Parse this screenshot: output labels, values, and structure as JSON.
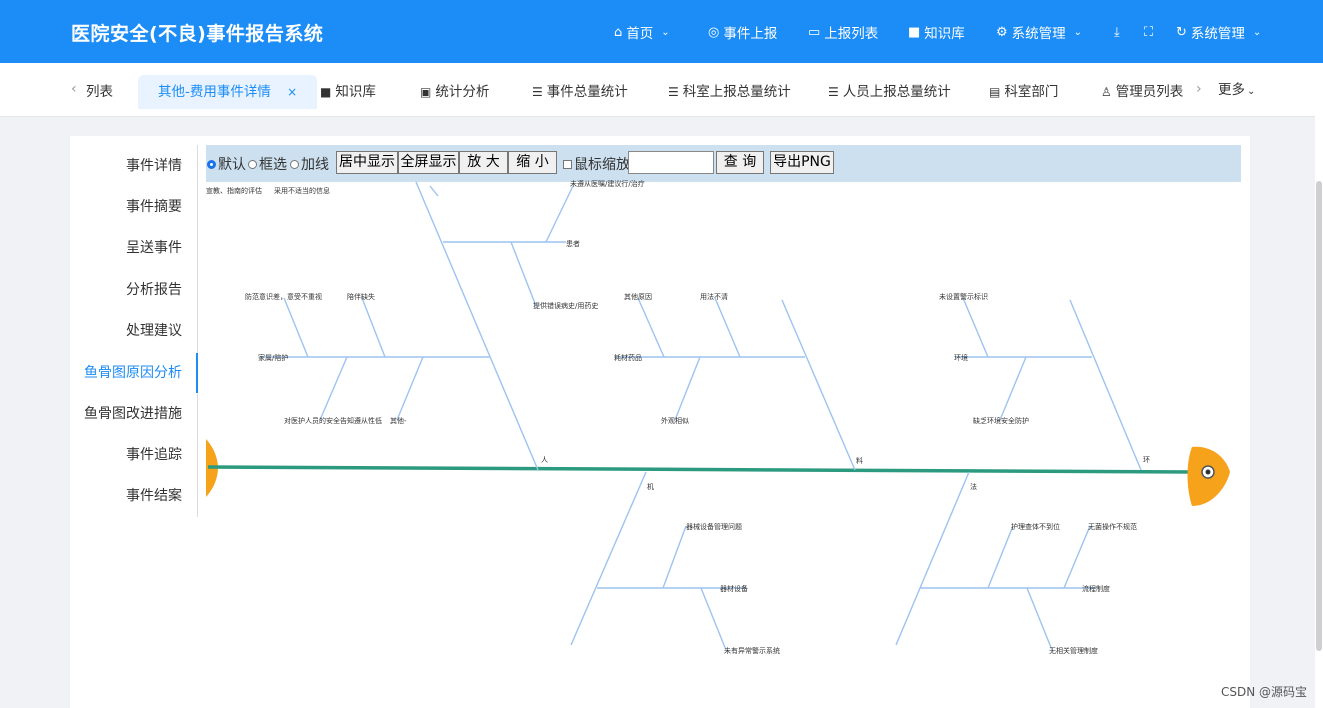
{
  "header": {
    "title": "医院安全(不良)事件报告系统",
    "nav": [
      {
        "label": "首页",
        "icon": "home-icon"
      },
      {
        "label": "事件上报",
        "icon": "report-icon"
      },
      {
        "label": "上报列表",
        "icon": "list-icon"
      },
      {
        "label": "知识库",
        "icon": "book-icon"
      },
      {
        "label": "系统管理",
        "icon": "gear-icon"
      },
      {
        "label": "系统管理",
        "icon": "refresh-icon"
      }
    ]
  },
  "tabs": {
    "back": "列表",
    "active": "其他-费用事件详情",
    "close": "×",
    "items": [
      "知识库",
      "统计分析",
      "事件总量统计",
      "科室上报总量统计",
      "人员上报总量统计",
      "科室部门",
      "管理员列表"
    ],
    "more": "更多"
  },
  "sidebar": {
    "items": [
      "事件详情",
      "事件摘要",
      "呈送事件",
      "分析报告",
      "处理建议",
      "鱼骨图原因分析",
      "鱼骨图改进措施",
      "事件追踪",
      "事件结案"
    ],
    "active_index": 5
  },
  "toolbar": {
    "modes": [
      "默认",
      "框选",
      "加线"
    ],
    "buttons": [
      "居中显示",
      "全屏显示",
      "放 大",
      "缩 小"
    ],
    "wheel_zoom": "鼠标缩放",
    "query": "查 询",
    "export": "导出PNG",
    "search_value": ""
  },
  "fishbone": {
    "colors": {
      "spine": "#2b9a7e",
      "bones": "#9dc3ef",
      "fish": "#f7a21b"
    },
    "categories": {
      "ren": "人",
      "liao": "料",
      "huan": "环",
      "ji": "机",
      "fa": "法"
    },
    "labels": {
      "cut1": "宣教、指南的评估",
      "cut2": "采用不适当的信息",
      "cut3": "未遵从医嘱/建议行/治疗",
      "patient": "患者",
      "history": "提供错误病史/用药史",
      "family_know": "防范意识差，意受不重视",
      "escort_absent": "陪伴缺失",
      "family": "家属/陪护",
      "staff_know": "对医护人员的安全告知遵从性低",
      "other": "其他-",
      "other_reason": "其他原因",
      "unclear": "用法不清",
      "supplies": "耗材药品",
      "similar": "外观相似",
      "no_warning": "未设置警示标识",
      "env": "环境",
      "no_protection": "缺乏环境安全防护",
      "device_mgmt": "器械设备管理问题",
      "device": "器材设备",
      "no_alarm": "未有异常警示系统",
      "supervision": "护理查体不到位",
      "nonstandard": "无菌操作不规范",
      "process": "流程制度",
      "no_rules": "无相关管理制度"
    }
  },
  "watermark": "CSDN @源码宝"
}
